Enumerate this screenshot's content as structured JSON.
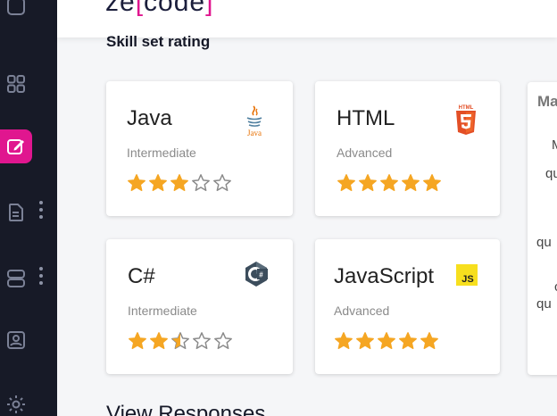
{
  "header": {
    "logo_left": "ze",
    "logo_bracket_open": "[",
    "logo_mid": "code",
    "logo_bracket_close": "]"
  },
  "section_title": "Skill set rating",
  "skills": [
    {
      "name": "Java",
      "level": "Intermediate",
      "rating": 3,
      "icon": "java-icon",
      "icon_text": "Java"
    },
    {
      "name": "HTML",
      "level": "Advanced",
      "rating": 5,
      "icon": "html5-icon",
      "icon_text": "HTML"
    },
    {
      "name": "C#",
      "level": "Intermediate",
      "rating": 2.5,
      "icon": "csharp-icon",
      "icon_text": "C#"
    },
    {
      "name": "JavaScript",
      "level": "Advanced",
      "rating": 5,
      "icon": "javascript-icon",
      "icon_text": "JS"
    }
  ],
  "partial_card": {
    "title": "Ma",
    "lines": [
      "M",
      "qu",
      "qu",
      "c",
      "qu"
    ]
  },
  "view_responses": "View Responses",
  "colors": {
    "accent": "#e0168f",
    "star": "#f5a623",
    "sidebar": "#171a27"
  }
}
